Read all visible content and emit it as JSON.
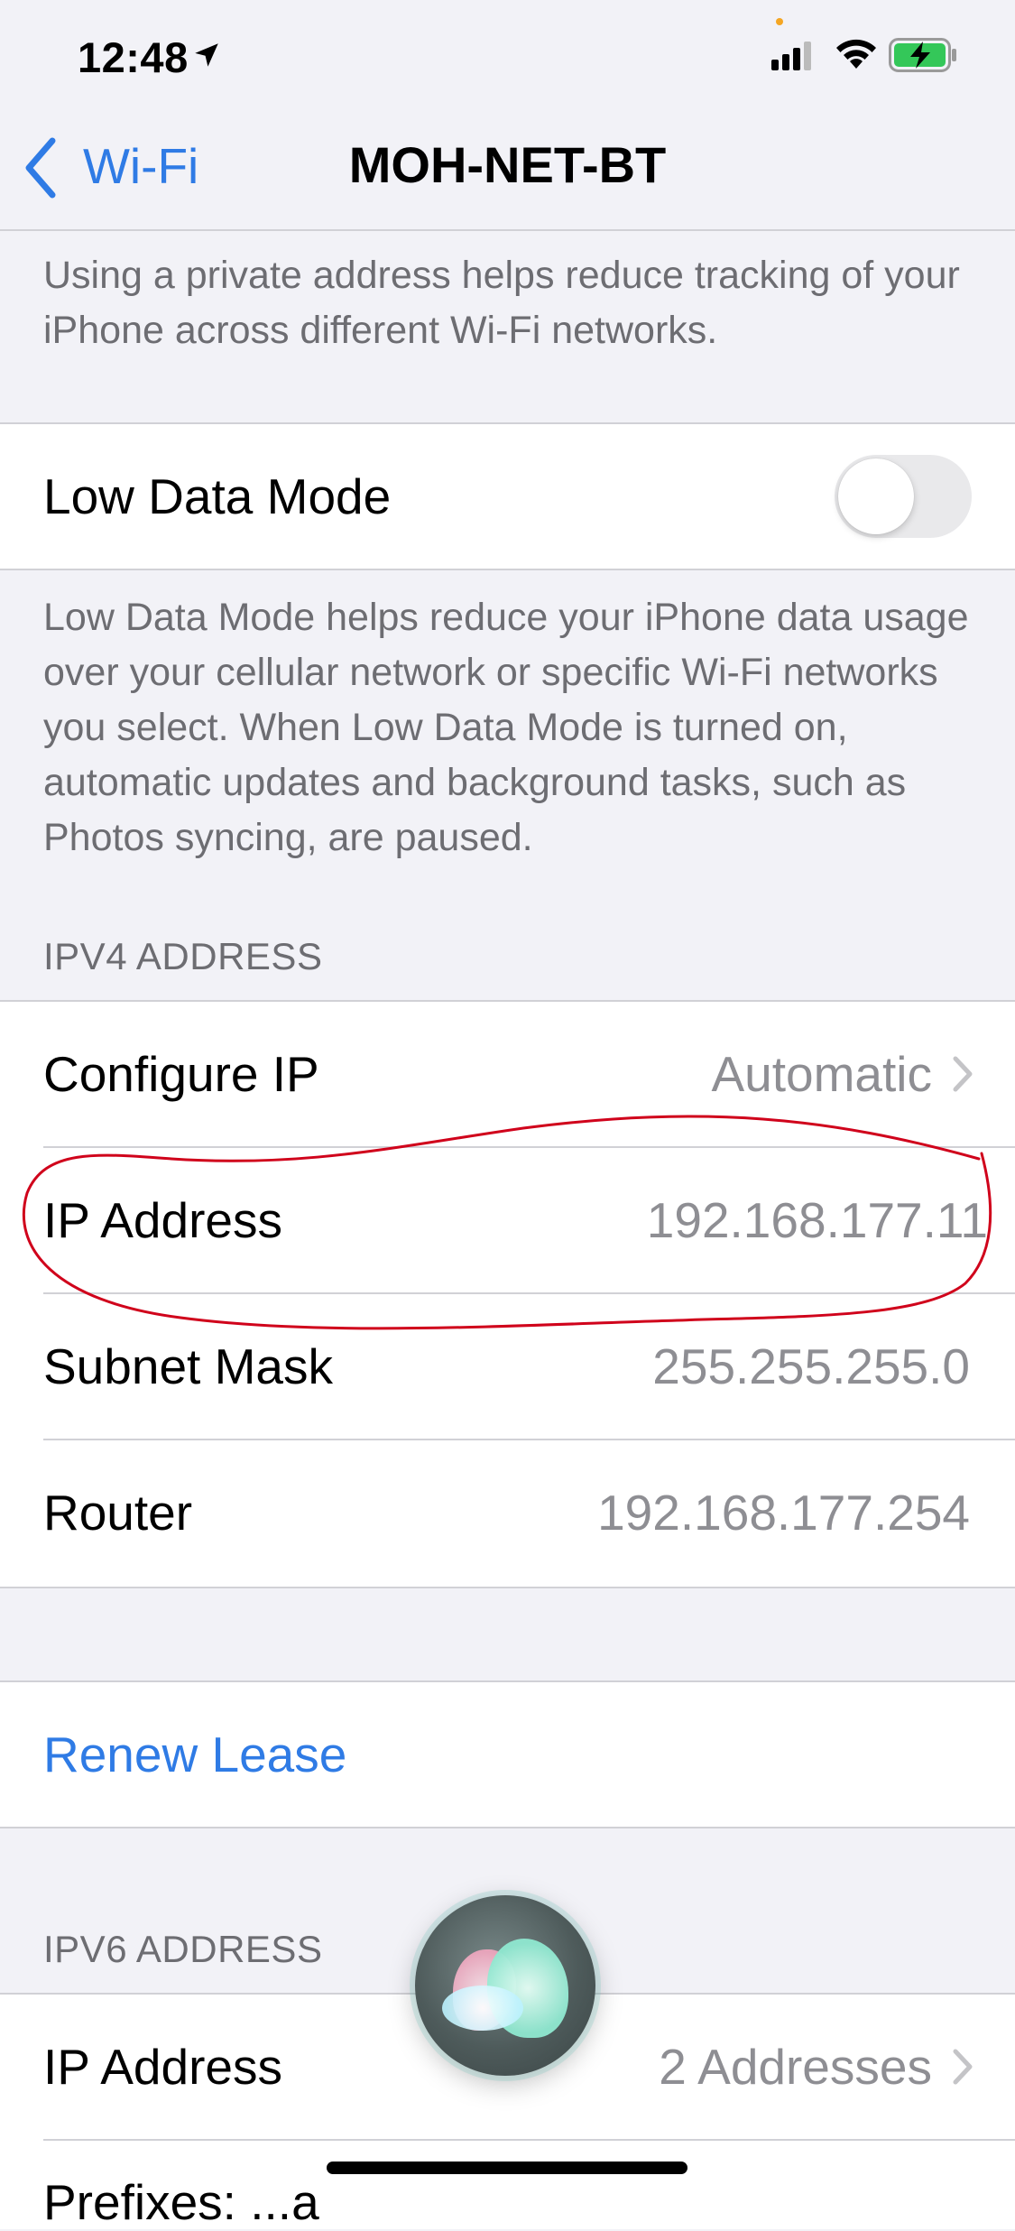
{
  "status_bar": {
    "time": "12:48",
    "icons": [
      "location-arrow-icon",
      "cellular-signal-icon",
      "wifi-icon",
      "battery-charging-icon"
    ],
    "battery_color": "#34c759"
  },
  "nav": {
    "back_label": "Wi-Fi",
    "title": "MOH-NET-BT"
  },
  "private_address_footer": "Using a private address helps reduce tracking of your iPhone across different Wi-Fi networks.",
  "low_data_mode": {
    "label": "Low Data Mode",
    "enabled": false,
    "footer": "Low Data Mode helps reduce your iPhone data usage over your cellular network or specific Wi-Fi networks you select. When Low Data Mode is turned on, automatic updates and background tasks, such as Photos syncing, are paused."
  },
  "ipv4": {
    "header": "IPV4 ADDRESS",
    "rows": [
      {
        "label": "Configure IP",
        "value": "Automatic",
        "chevron": true
      },
      {
        "label": "IP Address",
        "value": "192.168.177.11",
        "highlighted": true
      },
      {
        "label": "Subnet Mask",
        "value": "255.255.255.0"
      },
      {
        "label": "Router",
        "value": "192.168.177.254"
      }
    ]
  },
  "renew_lease_label": "Renew Lease",
  "ipv6": {
    "header": "IPV6 ADDRESS",
    "rows": [
      {
        "label": "IP Address",
        "value": "2 Addresses",
        "chevron": true
      }
    ],
    "partial_next_row": "Prefixes: ...a"
  },
  "colors": {
    "accent": "#2f7be5",
    "background": "#f2f2f7",
    "annotation": "#d0021b"
  }
}
